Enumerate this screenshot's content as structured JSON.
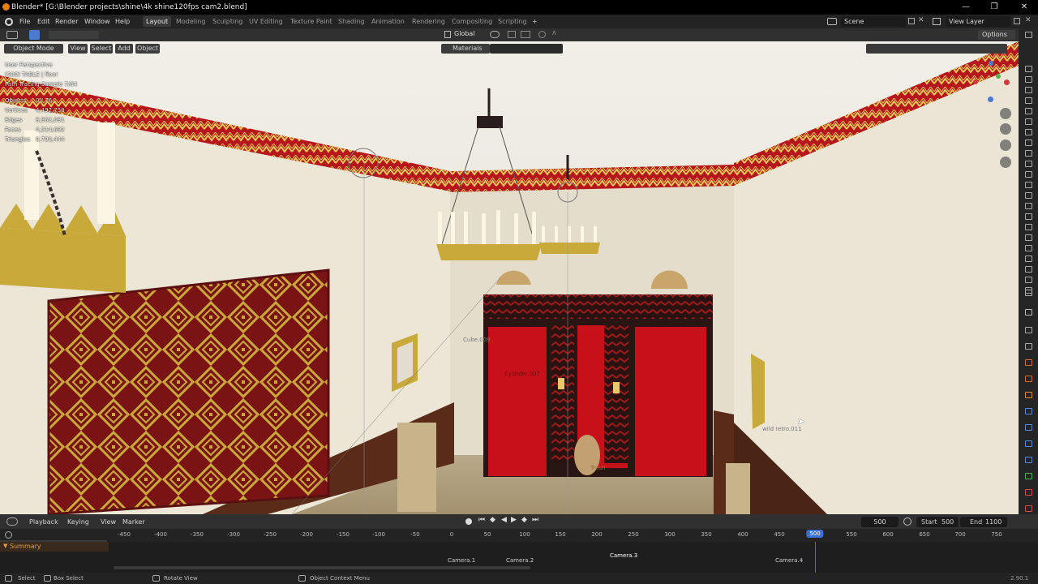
{
  "titlebar": {
    "title": "Blender* [G:\\Blender projects\\shine\\4k shine120fps cam2.blend]",
    "minimize": "—",
    "maximize": "❐",
    "close": "✕"
  },
  "menu": {
    "items": [
      "File",
      "Edit",
      "Render",
      "Window",
      "Help"
    ],
    "workspaces": [
      "Layout",
      "Modeling",
      "Sculpting",
      "UV Editing",
      "Texture Paint",
      "Shading",
      "Animation",
      "Rendering",
      "Compositing",
      "Scripting"
    ],
    "add_workspace": "+",
    "scene_label": "Scene",
    "view_layer_label": "View Layer"
  },
  "viewport_header": {
    "mode": "Object Mode",
    "view": "View",
    "select": "Select",
    "add": "Add",
    "object": "Object",
    "transform": "Global",
    "options": "Options",
    "material_filter": "Materials"
  },
  "overlay": {
    "perspective": "User Perspective",
    "collection": "(500) TABLE | floor",
    "render_sample": "Path Tracing Sample 7/64",
    "stats": [
      {
        "label": "Objects",
        "value": "0 / 76"
      },
      {
        "label": "Vertices",
        "value": "4,492,759"
      },
      {
        "label": "Edges",
        "value": "8,962,091"
      },
      {
        "label": "Faces",
        "value": "4,514,692"
      },
      {
        "label": "Triangles",
        "value": "8,793,444"
      }
    ]
  },
  "scene_objects": [
    "Cube.009",
    "Cylinder.007",
    "wild retro.011",
    "Trash"
  ],
  "timeline": {
    "menus": [
      "Playback",
      "Keying",
      "View",
      "Marker"
    ],
    "current_frame": "500",
    "start_label": "Start",
    "start": "500",
    "end_label": "End",
    "end": "1100",
    "ruler": [
      "-450",
      "-400",
      "-350",
      "-300",
      "-250",
      "-200",
      "-150",
      "-100",
      "-50",
      "0",
      "50",
      "100",
      "150",
      "200",
      "250",
      "300",
      "350",
      "400",
      "450",
      "500",
      "550",
      "600",
      "650",
      "700",
      "750"
    ],
    "summary": "Summary",
    "markers": [
      "Camera.1",
      "Camera.2",
      "Camera.3",
      "Camera.4"
    ]
  },
  "statusbar": {
    "select": "Select",
    "box_select": "Box Select",
    "rotate": "Rotate View",
    "context": "Object Context Menu",
    "version": "2.90.1"
  },
  "colors": {
    "accent_blue": "#4b7bd1",
    "active_frame": "#3d6fd0",
    "wall": "#e9e4d6",
    "border_red": "#b5171c",
    "door_red": "#c8101a",
    "gold": "#c8a93a"
  }
}
